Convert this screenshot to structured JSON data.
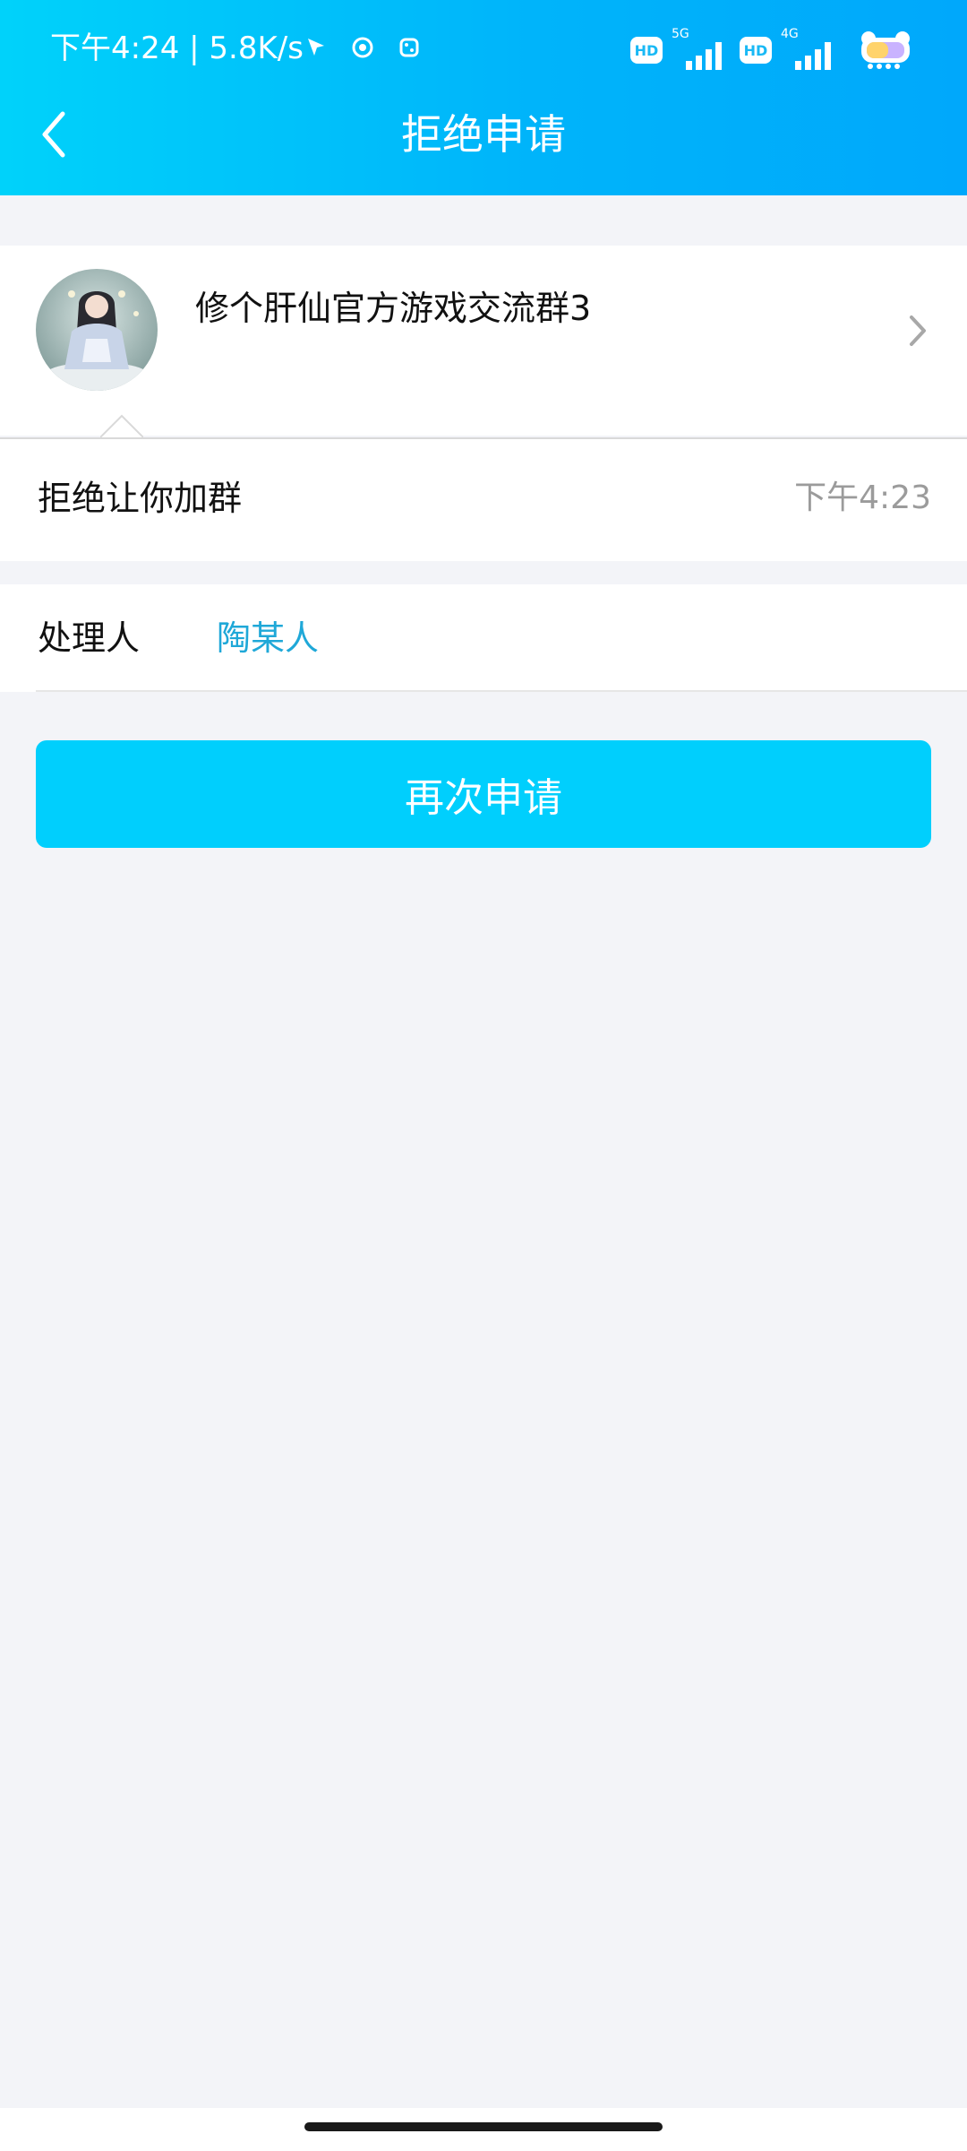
{
  "status_bar": {
    "time_speed": "下午4:24 | 5.8K/s",
    "hd_label_1": "HD",
    "network_1": "5G",
    "hd_label_2": "HD",
    "network_2": "4G",
    "icons": [
      "cursor-arrow-icon",
      "circle-app-icon",
      "dice-app-icon",
      "signal-icon",
      "battery-icon"
    ]
  },
  "header": {
    "title": "拒绝申请",
    "background_start": "#00d2fa",
    "background_end": "#00a8fb"
  },
  "group": {
    "name": "修个肝仙官方游戏交流群3"
  },
  "reject": {
    "message": "拒绝让你加群",
    "time": "下午4:23"
  },
  "handler": {
    "label": "处理人",
    "name": "陶某人",
    "name_color": "#1fa8d8"
  },
  "actions": {
    "reapply_label": "再次申请",
    "button_color": "#00cffd"
  }
}
